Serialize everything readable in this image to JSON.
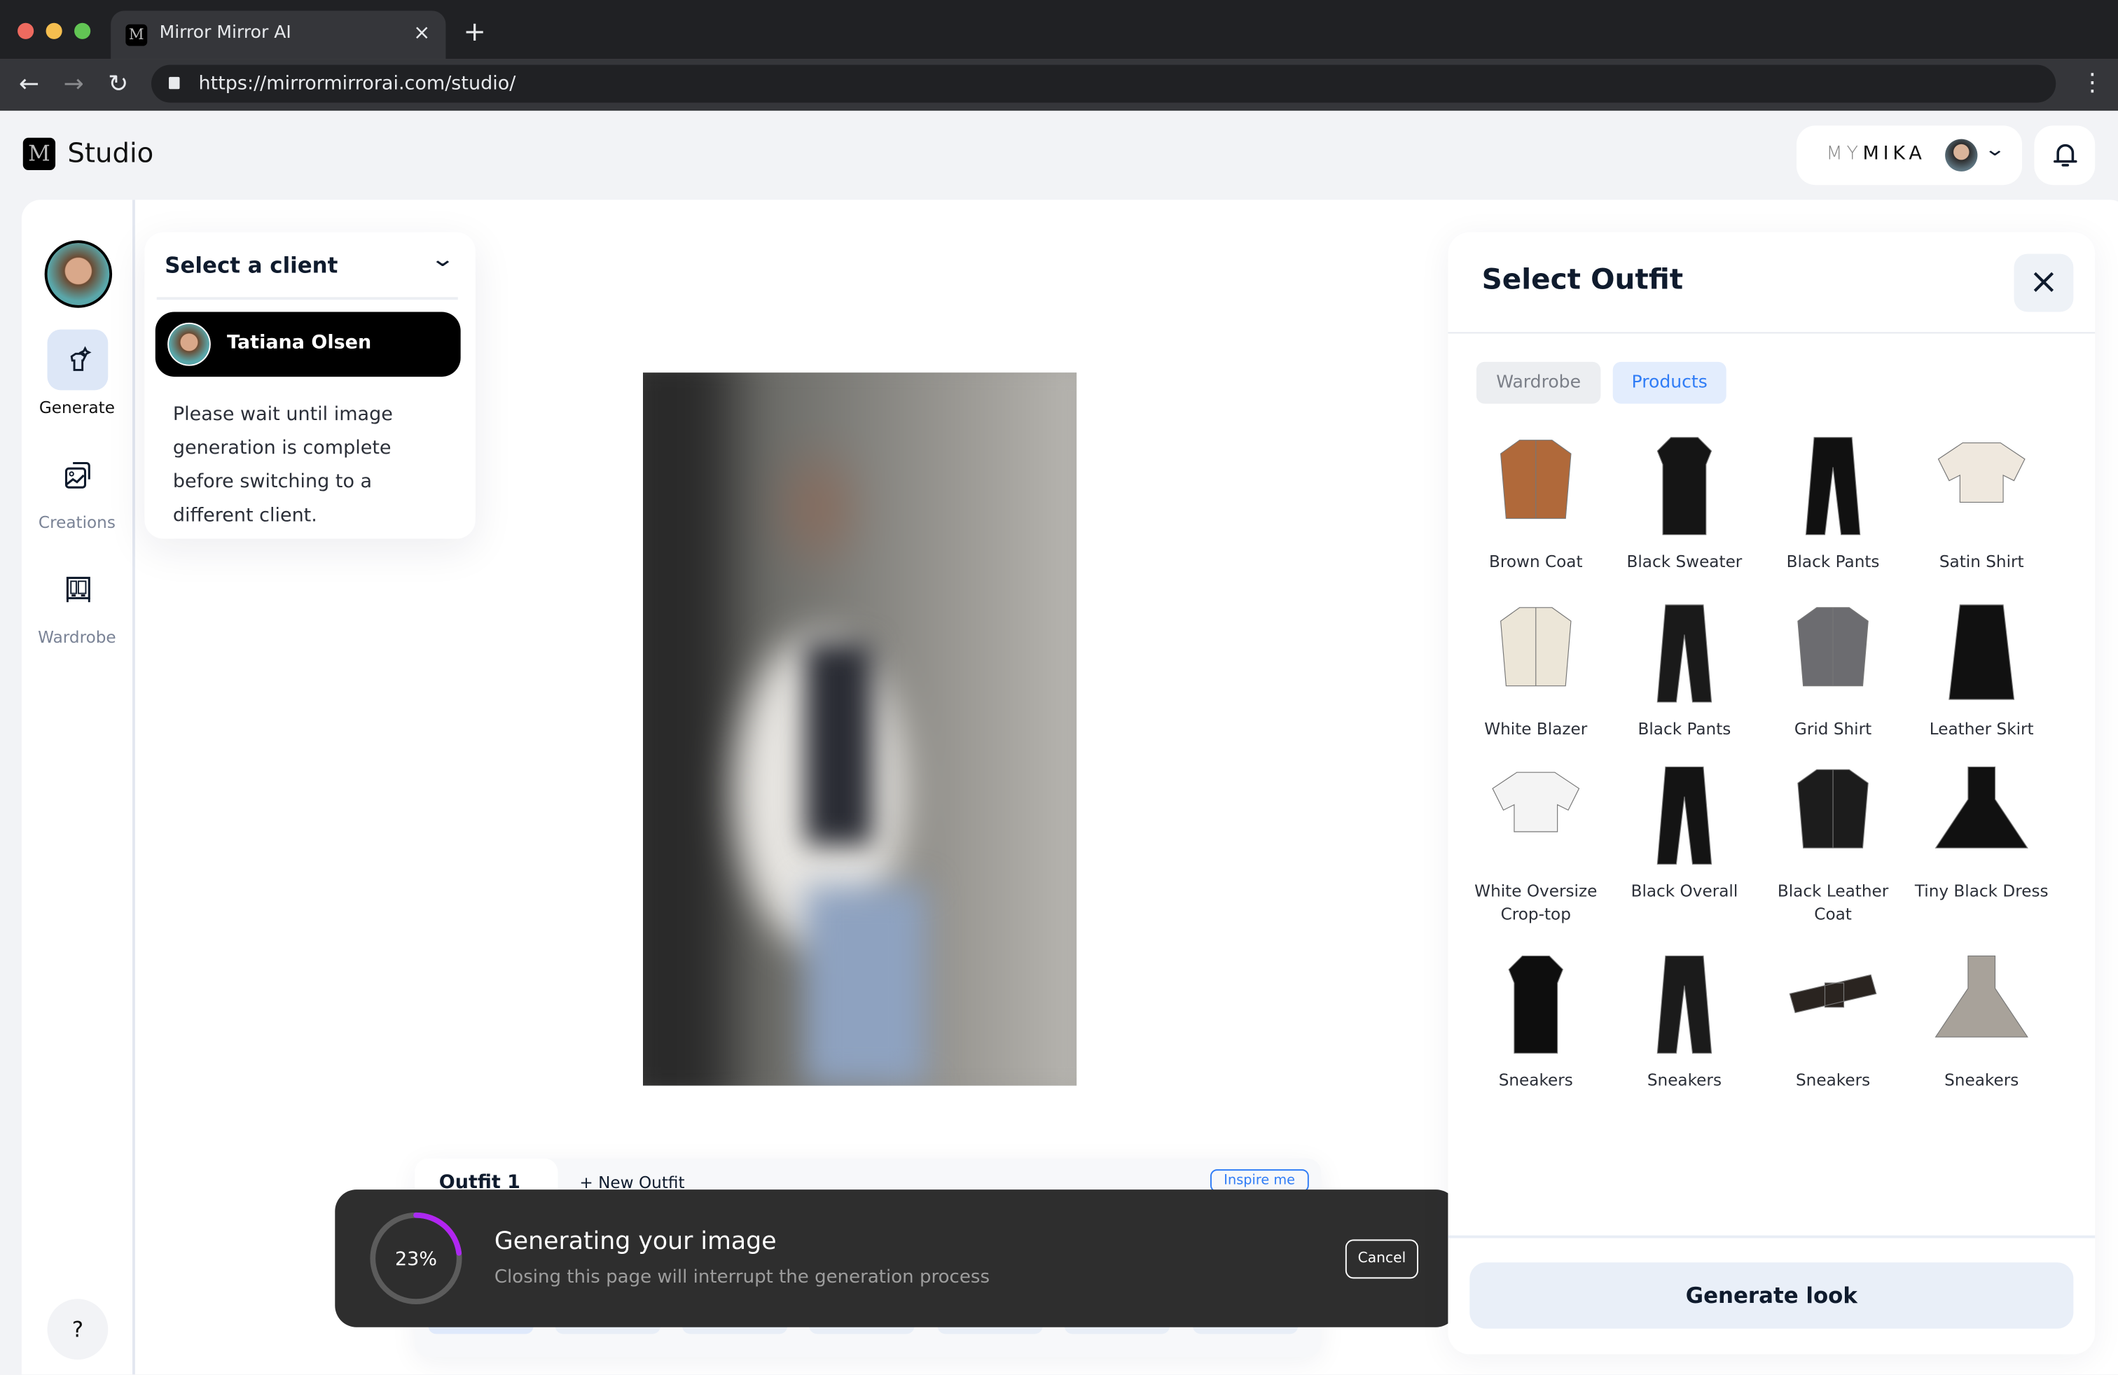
{
  "browser": {
    "tab_title": "Mirror Mirror AI",
    "url": "https://mirrormirrorai.com/studio/",
    "favicon": "M"
  },
  "header": {
    "app_title": "Studio",
    "account_prefix": "MY",
    "account_name": "MIKA"
  },
  "sidebar": {
    "items": [
      {
        "label": "Generate",
        "icon": "generate-shirt-icon",
        "active": true
      },
      {
        "label": "Creations",
        "icon": "creations-icon"
      },
      {
        "label": "Wardrobe",
        "icon": "wardrobe-icon"
      }
    ],
    "help": "?"
  },
  "client_panel": {
    "title": "Select a client",
    "selected_client": "Tatiana Olsen",
    "notice": "Please wait until image generation is complete before switching to a different client."
  },
  "outfit_bar": {
    "tabs": [
      "Outfit 1",
      "+ New Outfit"
    ],
    "inspire": "Inspire me"
  },
  "progress": {
    "percent_label": "23%",
    "percent": 23,
    "title": "Generating your image",
    "subtitle": "Closing this page will interrupt the generation process",
    "cancel": "Cancel",
    "colors": {
      "start": "#5b5ff6",
      "end": "#c21af0"
    }
  },
  "outfit_panel": {
    "title": "Select Outfit",
    "tabs": [
      "Wardrobe",
      "Products"
    ],
    "active_tab": "Products",
    "accent": "#2f7cf6",
    "generate": "Generate look",
    "products": [
      {
        "name": "Brown Coat",
        "kind": "coat",
        "color": "#b0693a"
      },
      {
        "name": "Black Sweater",
        "kind": "dress",
        "color": "#151515"
      },
      {
        "name": "Black Pants",
        "kind": "pants",
        "color": "#111111"
      },
      {
        "name": "Satin Shirt",
        "kind": "top",
        "color": "#efe8de"
      },
      {
        "name": "White Blazer",
        "kind": "coat",
        "color": "#ece6d8"
      },
      {
        "name": "Black Pants",
        "kind": "pants",
        "color": "#1a1a1a"
      },
      {
        "name": "Grid Shirt",
        "kind": "coat",
        "color": "#6c6c70"
      },
      {
        "name": "Leather Skirt",
        "kind": "skirt",
        "color": "#111111"
      },
      {
        "name": "White Oversize Crop-top",
        "kind": "top",
        "color": "#f4f4f4"
      },
      {
        "name": "Black Overall",
        "kind": "pants",
        "color": "#141414"
      },
      {
        "name": "Black Leather Coat",
        "kind": "coat",
        "color": "#1c1c1c"
      },
      {
        "name": "Tiny Black Dress",
        "kind": "flare",
        "color": "#111111"
      },
      {
        "name": "Sneakers",
        "kind": "dress",
        "color": "#0e0e0e"
      },
      {
        "name": "Sneakers",
        "kind": "pants",
        "color": "#1b1b1b"
      },
      {
        "name": "Sneakers",
        "kind": "belt",
        "color": "#2a2420"
      },
      {
        "name": "Sneakers",
        "kind": "flare",
        "color": "#a8a29a"
      }
    ]
  }
}
